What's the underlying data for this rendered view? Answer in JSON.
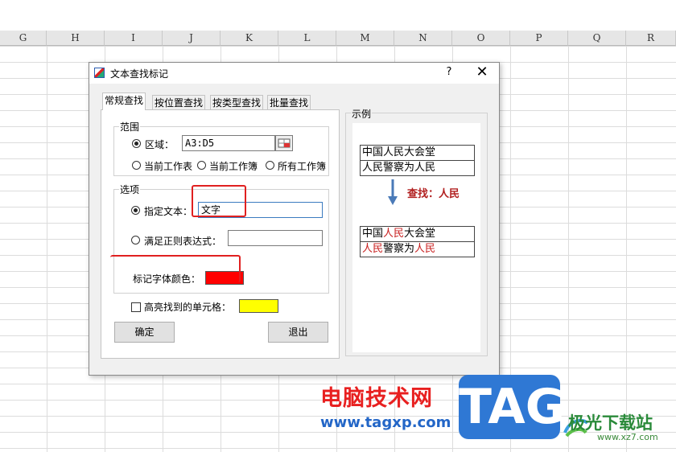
{
  "sheet": {
    "columns": [
      "G",
      "H",
      "I",
      "J",
      "K",
      "L",
      "M",
      "N",
      "O",
      "P",
      "Q",
      "R"
    ]
  },
  "dialog": {
    "title": "文本查找标记",
    "help": "?",
    "close": "X",
    "tabs": [
      "常规查找",
      "按位置查找",
      "按类型查找",
      "批量查找"
    ],
    "range": {
      "legend": "范围",
      "area_label": "区域：",
      "area_value": "A3:D5",
      "opt_sheet": "当前工作表",
      "opt_book": "当前工作簿",
      "opt_all": "所有工作簿"
    },
    "options": {
      "legend": "选项",
      "specify_text_label": "指定文本：",
      "specify_text_value": "文字",
      "regex_label": "满足正则表达式：",
      "regex_value": "",
      "mark_color_label": "标记字体颜色："
    },
    "highlight_label": "高亮找到的单元格：",
    "ok_label": "确定",
    "exit_label": "退出",
    "colors": {
      "mark": "#ff0000",
      "highlight": "#ffff00"
    },
    "example": {
      "legend": "示例",
      "before": [
        "中国人民大会堂",
        "人民警察为人民"
      ],
      "find_text": "查找：人民",
      "after_row1": {
        "a": "中国",
        "b": "人民",
        "c": "大会堂"
      },
      "after_row2": {
        "a": "人民",
        "b": "警察为",
        "c": "人民"
      }
    }
  },
  "watermark": {
    "site_cn": "电脑技术网",
    "site_url": "www.tagxp.com",
    "tag": "TAG",
    "brand": "极光下载站",
    "brand_url": "www.xz7.com"
  }
}
